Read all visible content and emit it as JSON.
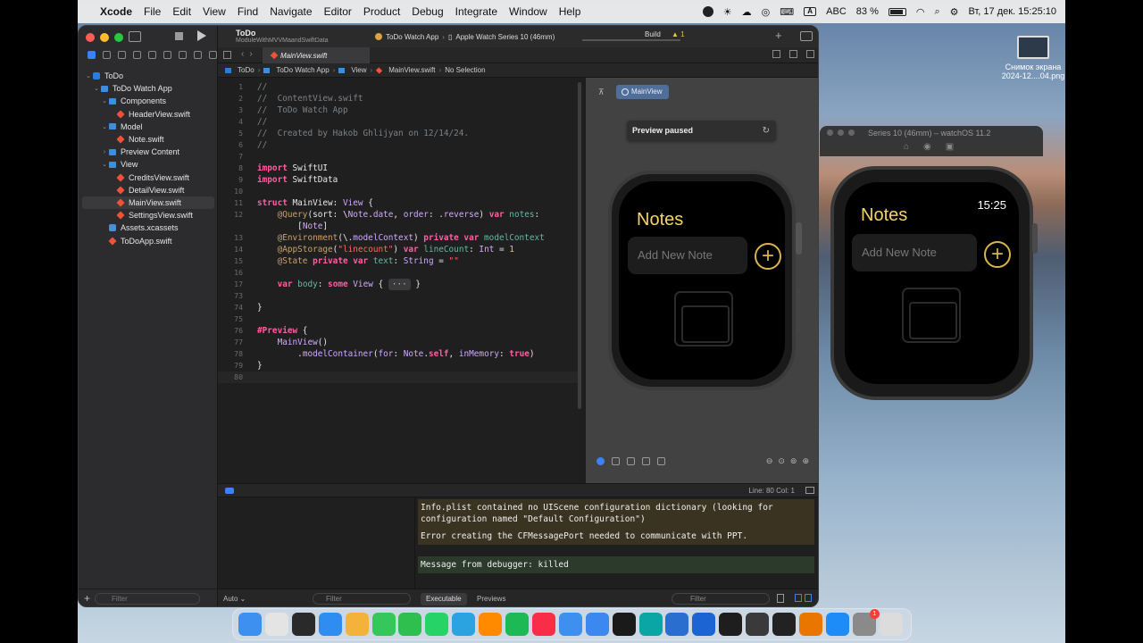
{
  "menubar": {
    "app": "Xcode",
    "items": [
      "File",
      "Edit",
      "View",
      "Find",
      "Navigate",
      "Editor",
      "Product",
      "Debug",
      "Integrate",
      "Window",
      "Help"
    ],
    "input_source": "ABC",
    "battery": "83 %",
    "datetime": "Вт, 17 дек.  15:25:10"
  },
  "desktop": {
    "file_name_1": "Снимок экрана",
    "file_name_2": "2024-12....04.png"
  },
  "simulator": {
    "title": "Series 10 (46mm) – watchOS 11.2",
    "notes": "Notes",
    "time": "15:25",
    "placeholder": "Add New Note",
    "add": "+"
  },
  "toolbar": {
    "project": "ToDo",
    "subtitle": "ModuleWithMVVMaandSwiftData",
    "scheme": "ToDo Watch App",
    "destination": "Apple Watch Series 10 (46mm)",
    "build": "Build",
    "warnings": "▲ 1"
  },
  "tab": {
    "active": "MainView.swift"
  },
  "jumpbar": [
    "ToDo",
    "ToDo Watch App",
    "View",
    "MainView.swift",
    "No Selection"
  ],
  "navigator": [
    {
      "label": "ToDo",
      "indent": 0,
      "icon": "proj",
      "disc": "⌄"
    },
    {
      "label": "ToDo Watch App",
      "indent": 1,
      "icon": "folder",
      "disc": "⌄"
    },
    {
      "label": "Components",
      "indent": 2,
      "icon": "folder",
      "disc": "⌄"
    },
    {
      "label": "HeaderView.swift",
      "indent": 3,
      "icon": "swift",
      "disc": ""
    },
    {
      "label": "Model",
      "indent": 2,
      "icon": "folder",
      "disc": "⌄"
    },
    {
      "label": "Note.swift",
      "indent": 3,
      "icon": "swift",
      "disc": ""
    },
    {
      "label": "Preview Content",
      "indent": 2,
      "icon": "folder",
      "disc": "›"
    },
    {
      "label": "View",
      "indent": 2,
      "icon": "folder",
      "disc": "⌄"
    },
    {
      "label": "CreditsView.swift",
      "indent": 3,
      "icon": "swift",
      "disc": ""
    },
    {
      "label": "DetailView.swift",
      "indent": 3,
      "icon": "swift",
      "disc": ""
    },
    {
      "label": "MainView.swift",
      "indent": 3,
      "icon": "swift",
      "disc": "",
      "selected": true
    },
    {
      "label": "SettingsView.swift",
      "indent": 3,
      "icon": "swift",
      "disc": ""
    },
    {
      "label": "Assets.xcassets",
      "indent": 2,
      "icon": "assets",
      "disc": ""
    },
    {
      "label": "ToDoApp.swift",
      "indent": 2,
      "icon": "swift",
      "disc": ""
    }
  ],
  "navigator_filter": "Filter",
  "editor": {
    "lines": [
      {
        "n": "1",
        "html": "<span class=\"c-com\">//</span>"
      },
      {
        "n": "2",
        "html": "<span class=\"c-com\">//  ContentView.swift</span>"
      },
      {
        "n": "3",
        "html": "<span class=\"c-com\">//  ToDo Watch App</span>"
      },
      {
        "n": "4",
        "html": "<span class=\"c-com\">//</span>"
      },
      {
        "n": "5",
        "html": "<span class=\"c-com\">//  Created by Hakob Ghlijyan on 12/14/24.</span>"
      },
      {
        "n": "6",
        "html": "<span class=\"c-com\">//</span>"
      },
      {
        "n": "7",
        "html": ""
      },
      {
        "n": "8",
        "html": "<span class=\"c-kw\">import</span> SwiftUI"
      },
      {
        "n": "9",
        "html": "<span class=\"c-kw\">import</span> SwiftData"
      },
      {
        "n": "10",
        "html": ""
      },
      {
        "n": "11",
        "html": "<span class=\"c-kw\">struct</span> MainView: <span class=\"c-type\">View</span> {"
      },
      {
        "n": "12",
        "html": "    <span class=\"c-attr\">@Query</span>(sort: \\<span class=\"c-type\">Note</span>.<span class=\"c-type\">date</span>, <span class=\"c-type\">order</span>: .<span class=\"c-type\">reverse</span>) <span class=\"c-kw\">var</span> <span class=\"c-fn\">notes</span>:"
      },
      {
        "n": "",
        "html": "        [<span class=\"c-type\">Note</span>]"
      },
      {
        "n": "13",
        "html": "    <span class=\"c-attr\">@Environment</span>(\\.<span class=\"c-type\">modelContext</span>) <span class=\"c-kw\">private var</span> <span class=\"c-fn\">modelContext</span>"
      },
      {
        "n": "14",
        "html": "    <span class=\"c-attr\">@AppStorage</span>(<span class=\"c-str\">\"linecount\"</span>) <span class=\"c-kw\">var</span> <span class=\"c-fn\">lineCount</span>: <span class=\"c-type\">Int</span> = <span class=\"c-num\">1</span>"
      },
      {
        "n": "15",
        "html": "    <span class=\"c-attr\">@State</span> <span class=\"c-kw\">private var</span> <span class=\"c-fn\">text</span>: <span class=\"c-type\">String</span> = <span class=\"c-str\">\"\"</span>"
      },
      {
        "n": "16",
        "html": ""
      },
      {
        "n": "17",
        "html": "    <span class=\"c-kw\">var</span> <span class=\"c-fn\">body</span>: <span class=\"c-kw\">some</span> <span class=\"c-type\">View</span> { <span class=\"fold\">···</span> }"
      },
      {
        "n": "73",
        "html": ""
      },
      {
        "n": "74",
        "html": "}"
      },
      {
        "n": "75",
        "html": ""
      },
      {
        "n": "76",
        "html": "<span class=\"c-kw\">#Preview</span> {"
      },
      {
        "n": "77",
        "html": "    <span class=\"c-type\">MainView</span>()"
      },
      {
        "n": "78",
        "html": "        .<span class=\"c-type\">modelContainer</span>(<span class=\"c-type\">for</span>: <span class=\"c-type\">Note</span>.<span class=\"c-kw\">self</span>, <span class=\"c-type\">inMemory</span>: <span class=\"c-kw\">true</span>)"
      },
      {
        "n": "79",
        "html": "}"
      },
      {
        "n": "80",
        "html": ""
      }
    ]
  },
  "canvas": {
    "chip": "MainView",
    "paused": "Preview paused",
    "notes": "Notes",
    "placeholder": "Add New Note",
    "add": "+"
  },
  "debug": {
    "position": "Line: 80  Col: 1",
    "messages": [
      {
        "kind": "warn",
        "text": "Info.plist contained no UIScene configuration dictionary (looking for configuration named \"Default Configuration\")"
      },
      {
        "kind": "warn",
        "text": "Error creating the CFMessagePort needed to communicate with PPT."
      },
      {
        "kind": "info",
        "text": "Message from debugger: killed"
      }
    ],
    "auto": "Auto ⌄",
    "filter1": "Filter",
    "tab_exec": "Executable",
    "tab_prev": "Previews",
    "filter2": "Filter"
  },
  "dock": {
    "badge": "1",
    "apps": [
      {
        "name": "finder",
        "color": "#3d8ff0"
      },
      {
        "name": "launchpad",
        "color": "#e4e4e4"
      },
      {
        "name": "terminal",
        "color": "#2a2a2a"
      },
      {
        "name": "safari",
        "color": "#2f8cf0"
      },
      {
        "name": "photos",
        "color": "#f3b33a"
      },
      {
        "name": "messages",
        "color": "#35c759"
      },
      {
        "name": "facetime",
        "color": "#2fbf4f"
      },
      {
        "name": "whatsapp",
        "color": "#25d366"
      },
      {
        "name": "telegram",
        "color": "#2aa3e0"
      },
      {
        "name": "books",
        "color": "#ff8a00"
      },
      {
        "name": "spotify",
        "color": "#1db954"
      },
      {
        "name": "music",
        "color": "#fa2d48"
      },
      {
        "name": "mail",
        "color": "#3d8ff0"
      },
      {
        "name": "testflight",
        "color": "#3a88f0"
      },
      {
        "name": "chatgpt",
        "color": "#1a1a1a"
      },
      {
        "name": "simulator-app",
        "color": "#0aa5a5"
      },
      {
        "name": "xcode-app",
        "color": "#2a6fd0"
      },
      {
        "name": "instruments",
        "color": "#1c64d4"
      },
      {
        "name": "figma",
        "color": "#1e1e1e"
      },
      {
        "name": "davinci",
        "color": "#3a3a3a"
      },
      {
        "name": "blackmagic",
        "color": "#222"
      },
      {
        "name": "blender",
        "color": "#ea7600"
      },
      {
        "name": "appstore",
        "color": "#1d8cf8"
      },
      {
        "name": "settings",
        "color": "#8a8a8a"
      },
      {
        "name": "trash",
        "color": "#dcdcdc"
      }
    ]
  }
}
